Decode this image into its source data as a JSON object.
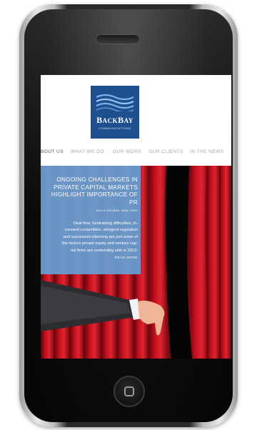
{
  "logo": {
    "name_big_b": "B",
    "name_rest_1": "ACK",
    "name_big_b2": "B",
    "name_rest_2": "AY",
    "subtitle": "COMMUNICATIONS"
  },
  "nav": {
    "items": [
      {
        "label": "BOUT US"
      },
      {
        "label": "WHAT WE DO"
      },
      {
        "label": "OUR WORK"
      },
      {
        "label": "OUR CLIENTS"
      },
      {
        "label": "IN THE NEWS"
      }
    ]
  },
  "article": {
    "title_line1": "ONGOING CHALLENGES IN",
    "title_line2": "PRIVATE CAPITAL MARKETS",
    "title_line3": "HIGHLIGHT IMPORTANCE OF PR",
    "byline": "KELLY HOLMAN, NEW YORK",
    "body_line1": "Deal flow, fundraising difficulties, in-",
    "body_line2": "creased competition, stringent regulation",
    "body_line3": "and succession planning are just some of",
    "body_line4": "the factors private equity and venture cap-",
    "body_line5": "ital firms are contending with in 2013.",
    "read_more": "READ MORE"
  },
  "colors": {
    "logo_blue": "#1e4f8f",
    "card_blue": "#659fd2",
    "curtain_red": "#b0101b",
    "nav_gray": "#a9a9a9",
    "nav_active": "#555555"
  },
  "icons": {
    "home_button": "home-square-icon",
    "speaker": "speaker-grille"
  }
}
